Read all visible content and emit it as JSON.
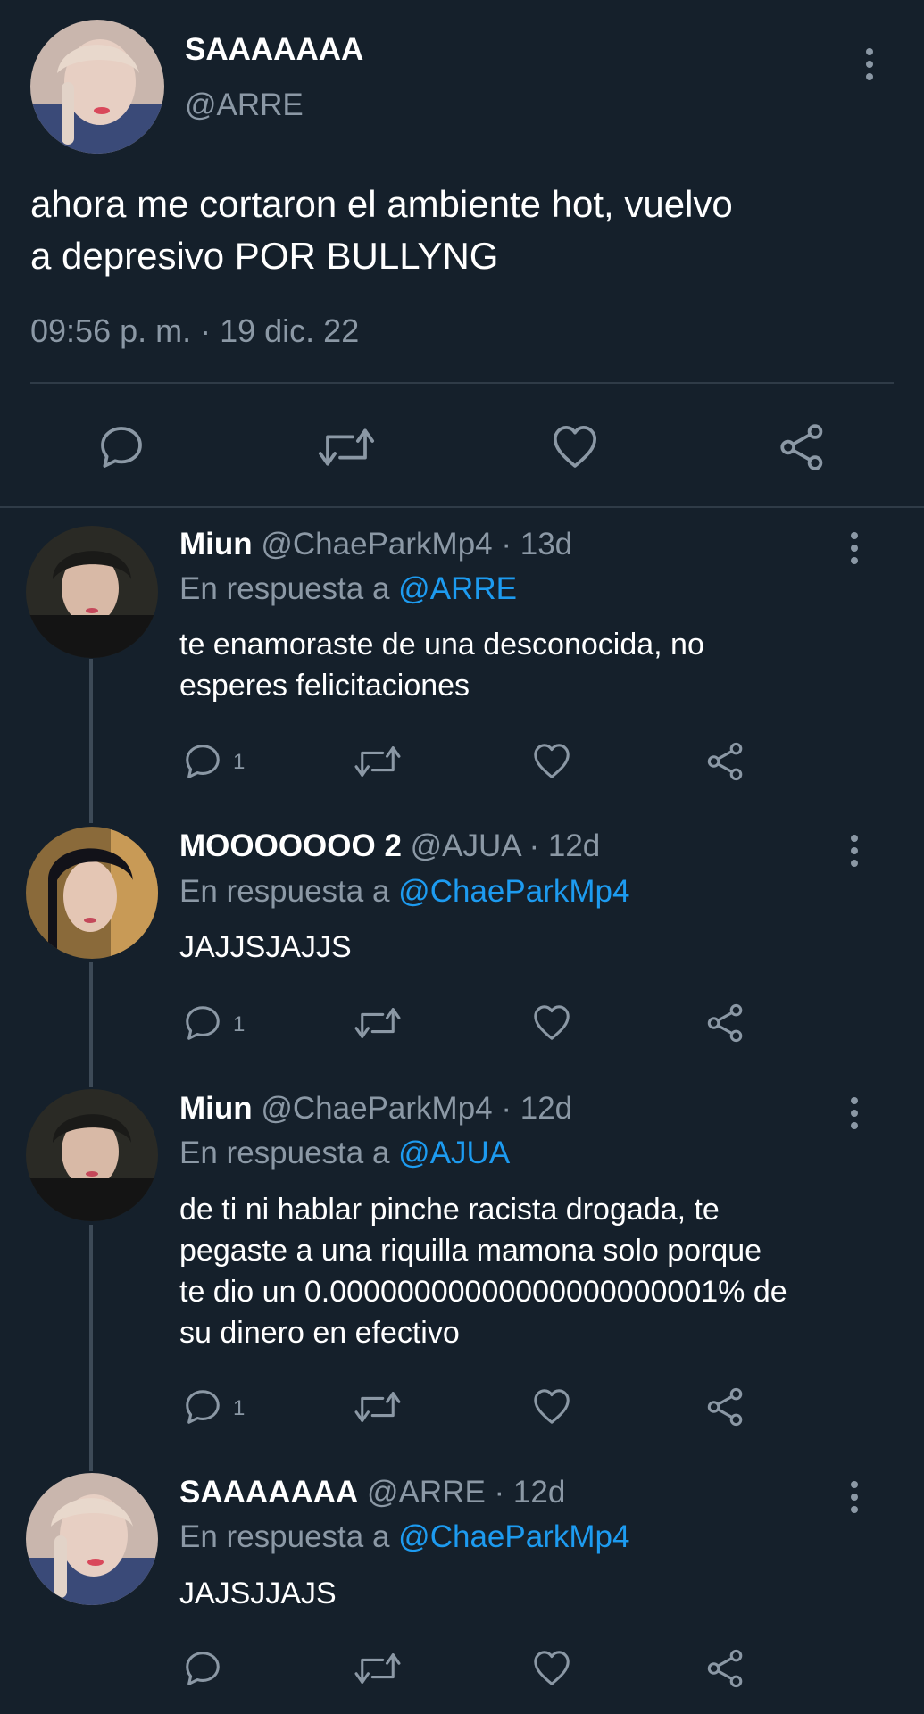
{
  "main_tweet": {
    "display_name": "SAAAAAAA",
    "handle": "@ARRE",
    "text_line1": "ahora me cortaron el ambiente hot, vuelvo",
    "text_line2": "a depresivo POR BULLYNG",
    "timestamp": "09:56 p. m. · 19 dic. 22",
    "actions": [
      "reply-icon",
      "retweet-icon",
      "like-icon",
      "share-icon"
    ]
  },
  "replies": [
    {
      "display_name": "Miun",
      "handle": "@ChaeParkMp4",
      "age": "· 13d",
      "reply_prefix": "En respuesta a",
      "reply_to": "@ARRE",
      "lines": [
        "te enamoraste de una desconocida, no",
        "esperes felicitaciones"
      ],
      "reply_count": "1"
    },
    {
      "display_name": "MOOOOOOO 2",
      "handle": "@AJUA",
      "age": "· 12d",
      "reply_prefix": "En respuesta a",
      "reply_to": "@ChaeParkMp4",
      "lines": [
        "JAJJSJAJJS"
      ],
      "reply_count": "1"
    },
    {
      "display_name": "Miun",
      "handle": "@ChaeParkMp4",
      "age": "· 12d",
      "reply_prefix": "En respuesta a",
      "reply_to": "@AJUA",
      "lines": [
        "de ti ni hablar pinche racista drogada, te",
        "pegaste a una riquilla mamona solo porque",
        "te dio un 0.00000000000000000000001% de",
        "su dinero en efectivo"
      ],
      "reply_count": "1"
    },
    {
      "display_name": "SAAAAAAA",
      "handle": "@ARRE",
      "age": "· 12d",
      "reply_prefix": "En respuesta a",
      "reply_to": "@ChaeParkMp4",
      "lines": [
        "JAJSJJAJS"
      ],
      "reply_count": ""
    }
  ],
  "colors": {
    "background": "#15202b",
    "text": "#ffffff",
    "muted": "#8b98a5",
    "accent": "#1d9bf0"
  }
}
